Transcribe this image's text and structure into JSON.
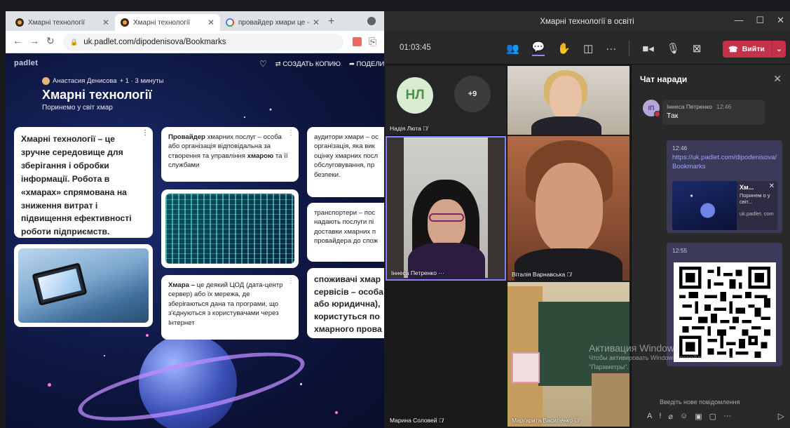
{
  "browser": {
    "tabs": [
      {
        "title": "Хмарні технології",
        "active": false
      },
      {
        "title": "Хмарні технології",
        "active": true
      },
      {
        "title": "провайдер хмари це - П",
        "active": false
      }
    ],
    "url": "uk.padlet.com/dipodenisova/Bookmarks"
  },
  "padlet": {
    "brand": "padlet",
    "actions": {
      "remake": "СОЗДАТЬ КОПИЮ",
      "share": "ПОДЕЛИТЬ"
    },
    "author": "Анастасия Денисова",
    "author_meta": "+ 1 · 3 минуты",
    "title": "Хмарні технології",
    "subtitle": "Поринемо у світ хмар",
    "cards": {
      "c1": "Хмарні технології – це зручне середовище для зберігання і обробки інформації. Робота в «хмарах» спрямована на зниження витрат і підвищення ефективності роботи підприємств.",
      "c2_bold": "Провайдер",
      "c2_rest": " хмарних послуг – особа або організація відповідальна за створення та управління ",
      "c2_bold2": "хмарою",
      "c2_tail": " та її службами",
      "c5_bold": "Хмара –",
      "c5_rest": " це деякий ЦОД (дата-центр сервер) або їх мережа, де зберігаються дана та програми, що з'єднуються з користувачами через Інтернет",
      "c6": [
        "аудитори хмари – ос",
        "організація, яка вик",
        "оцінку хмарних посл",
        "обслуговування, пр",
        "безпеки."
      ],
      "c7": [
        "транспортери – пос",
        "надають послуги пі",
        "доставки хмарних п",
        "провайдера до спож"
      ],
      "c8": [
        "споживачі хмар",
        "сервісів – особа",
        "або юридична),",
        "користуться по",
        "хмарного прова"
      ]
    }
  },
  "teams": {
    "window_title": "Хмарні технології в освіті",
    "timer": "01:03:45",
    "leave_label": "Вийти",
    "participants": {
      "p1_initials": "НЛ",
      "p1_name": "Надія Люта",
      "more": "+9",
      "p3_name": "Іннеса Петренко",
      "p3_more": "···",
      "p4_name": "Віталія Варнавська",
      "p5_name": "Марина Соловей",
      "p6_name": "Маргарита Василенко"
    },
    "chat": {
      "header": "Чат наради",
      "msg1": {
        "initials": "ІП",
        "author": "Іннеса Петренко",
        "time": "12:46",
        "text": "Так"
      },
      "msg2": {
        "time": "12:46",
        "link": "https://uk.padlet.com/dipodenisova/Bookmarks",
        "preview_title": "Хм...",
        "preview_desc": "Поринем о у світ...",
        "preview_url": "uk.padlet. com"
      },
      "msg3": {
        "time": "12:55"
      },
      "input_placeholder": "Введіть нове повідомлення"
    },
    "activation": {
      "title": "Активация Windows",
      "line1": "Чтобы активировать Windows, перейдите в раздел",
      "line2": "\"Параметры\"."
    }
  }
}
